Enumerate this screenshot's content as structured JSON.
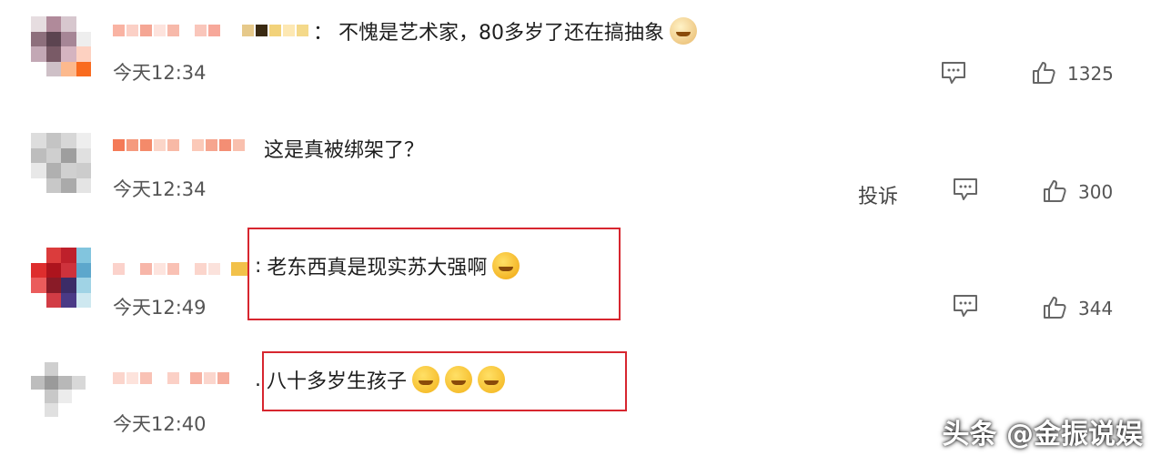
{
  "comments": [
    {
      "text": "不愧是艺术家，80多岁了还在搞抽象",
      "time": "今天12:34",
      "likes": "1325",
      "emoji": "doge-emoji"
    },
    {
      "text": "这是真被绑架了？",
      "time": "今天12:34",
      "report": "投诉",
      "likes": "300"
    },
    {
      "text": "老东西真是现实苏大强啊",
      "time": "今天12:49",
      "likes": "344",
      "emoji": "laugh-cry-emoji"
    },
    {
      "text": "八十多岁生孩子",
      "time": "今天12:40",
      "emoji": "smile-emoji"
    }
  ],
  "watermark": "头条 @金振说娱",
  "colors": {
    "highlight": "#d7262f",
    "text": "#1e1e1e",
    "meta": "#555555"
  }
}
